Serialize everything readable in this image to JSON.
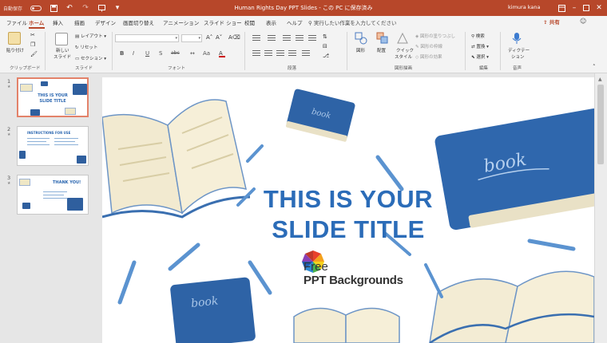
{
  "titlebar": {
    "autosave": "自動保存",
    "doc_title": "Human Rights Day PPT Slides - この PC に保存済み",
    "user": "kimura kana",
    "color": "#b7472a"
  },
  "tabs": [
    {
      "label": "ファイル"
    },
    {
      "label": "ホーム",
      "active": true
    },
    {
      "label": "挿入"
    },
    {
      "label": "描画"
    },
    {
      "label": "デザイン"
    },
    {
      "label": "画面切り替え"
    },
    {
      "label": "アニメーション"
    },
    {
      "label": "スライド ショー"
    },
    {
      "label": "校閲"
    },
    {
      "label": "表示"
    },
    {
      "label": "ヘルプ"
    }
  ],
  "search_hint": "実行したい作業を入力してください",
  "share_label": "共有",
  "ribbon": {
    "clipboard": {
      "paste": "貼り付け",
      "label": "クリップボード"
    },
    "slides": {
      "new_slide_line1": "新しい",
      "new_slide_line2": "スライド",
      "layout": "レイアウト",
      "reset": "リセット",
      "section": "セクション",
      "label": "スライド"
    },
    "font": {
      "label": "フォント",
      "bold": "B",
      "italic": "I",
      "underline": "U",
      "shadow": "S",
      "strike": "abc",
      "grow": "A",
      "shrink": "A",
      "clear": "A"
    },
    "paragraph": {
      "label": "段落"
    },
    "drawing": {
      "shapes": "図形",
      "arrange": "配置",
      "quick_styles_line1": "クイック",
      "quick_styles_line2": "スタイル",
      "fill": "図形の塗りつぶし",
      "outline": "図形の枠線",
      "effects": "図形の効果",
      "label": "図形描画"
    },
    "editing": {
      "find": "検索",
      "replace": "置換",
      "select": "選択",
      "label": "編集"
    },
    "voice": {
      "dictate_line1": "ディクテー",
      "dictate_line2": "ション",
      "label": "音声"
    }
  },
  "thumbnails": [
    {
      "number": "1",
      "title_line1": "THIS IS YOUR",
      "title_line2": "SLIDE TITLE",
      "selected": true
    },
    {
      "number": "2",
      "title_line1": "INSTRUCTIONS FOR USE",
      "selected": false
    },
    {
      "number": "3",
      "title_line1": "THANK YOU!",
      "selected": false
    }
  ],
  "slide": {
    "title_line1": "THIS IS YOUR",
    "title_line2": "SLIDE TITLE",
    "title_color": "#2b6cb8",
    "book_label": "book",
    "logo_line1": "Free",
    "logo_line2": "PPT Backgrounds"
  }
}
